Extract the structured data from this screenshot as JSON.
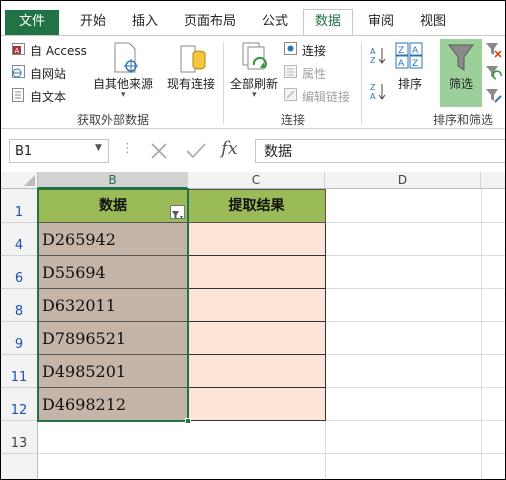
{
  "tabs": [
    "文件",
    "开始",
    "插入",
    "页面布局",
    "公式",
    "数据",
    "审阅",
    "视图"
  ],
  "ribbon": {
    "get_external": {
      "access": "自 Access",
      "web": "自网站",
      "text": "自文本",
      "other": "自其他来源",
      "existing": "现有连接",
      "group_label": "获取外部数据"
    },
    "connections": {
      "refresh_all": "全部刷新",
      "connections": "连接",
      "properties": "属性",
      "edit_links": "编辑链接",
      "group_label": "连接"
    },
    "sort_filter": {
      "sort": "排序",
      "filter": "筛选",
      "group_label": "排序和筛选"
    }
  },
  "formula_bar": {
    "name_box": "B1",
    "fx": "fx",
    "content": "数据"
  },
  "columns": [
    "B",
    "C",
    "D"
  ],
  "rows": [
    {
      "num": "1"
    },
    {
      "num": "4"
    },
    {
      "num": "6"
    },
    {
      "num": "8"
    },
    {
      "num": "9"
    },
    {
      "num": "11"
    },
    {
      "num": "12"
    },
    {
      "num": "13"
    }
  ],
  "table": {
    "header_b": "数据",
    "header_c": "提取结果",
    "values": [
      "D265942",
      "D55694",
      "D632011",
      "D7896521",
      "D4985201",
      "D4698212"
    ]
  },
  "colors": {
    "accent": "#217346",
    "header_fill": "#9bbb59",
    "data_fill": "#c5b4a8",
    "result_fill": "#fce4d6"
  }
}
